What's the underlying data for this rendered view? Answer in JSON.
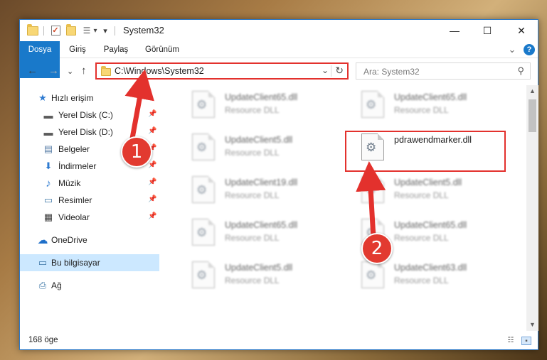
{
  "window": {
    "title": "System32",
    "controls": {
      "minimize": "—",
      "maximize": "☐",
      "close": "✕"
    }
  },
  "quick_access_toolbar": {
    "dropdown_glyph": "▾"
  },
  "ribbon": {
    "tabs": [
      {
        "label": "Dosya"
      },
      {
        "label": "Giriş"
      },
      {
        "label": "Paylaş"
      },
      {
        "label": "Görünüm"
      }
    ],
    "expand_glyph": "⌄",
    "help_glyph": "?"
  },
  "navigation": {
    "back": "←",
    "forward": "→",
    "recent": "⌄",
    "up": "↑",
    "address": "C:\\Windows\\System32",
    "address_dropdown": "⌄",
    "refresh": "↻",
    "search_placeholder": "Ara: System32",
    "search_glyph": "⚲"
  },
  "sidebar": {
    "items": [
      {
        "label": "Hızlı erişim",
        "icon": "star-icon",
        "glyph": "★",
        "color": "#2f7bd1"
      },
      {
        "label": "Yerel Disk (C:)",
        "icon": "drive-c-icon",
        "glyph": "▬",
        "color": "#5b5b5b",
        "pin": "📌"
      },
      {
        "label": "Yerel Disk (D:)",
        "icon": "drive-d-icon",
        "glyph": "▬",
        "color": "#5b5b5b",
        "pin": "📌"
      },
      {
        "label": "Belgeler",
        "icon": "documents-icon",
        "glyph": "▤",
        "color": "#5a7fa8",
        "pin": "📌"
      },
      {
        "label": "İndirmeler",
        "icon": "downloads-icon",
        "glyph": "⬇",
        "color": "#2f7bd1",
        "pin": "📌"
      },
      {
        "label": "Müzik",
        "icon": "music-icon",
        "glyph": "♪",
        "color": "#2f7bd1",
        "pin": "📌"
      },
      {
        "label": "Resimler",
        "icon": "pictures-icon",
        "glyph": "▭",
        "color": "#3f78a8",
        "pin": "📌"
      },
      {
        "label": "Videolar",
        "icon": "videos-icon",
        "glyph": "▦",
        "color": "#3c3c3c",
        "pin": "📌"
      },
      {
        "label": "OneDrive",
        "icon": "onedrive-icon",
        "glyph": "☁",
        "color": "#1e6fc9"
      },
      {
        "label": "Bu bilgisayar",
        "icon": "computer-icon",
        "glyph": "▭",
        "color": "#3f78a8",
        "selected": true
      },
      {
        "label": "Ağ",
        "icon": "network-icon",
        "glyph": "⎙",
        "color": "#3f78a8"
      }
    ]
  },
  "files": {
    "left_column": [
      {
        "name": "UpdateClient65.dll",
        "type": "Resource DLL"
      },
      {
        "name": "UpdateClient5.dll",
        "type": "Resource DLL"
      },
      {
        "name": "UpdateClient19.dll",
        "type": "Resource DLL"
      },
      {
        "name": "UpdateClient65.dll",
        "type": "Resource DLL"
      },
      {
        "name": "UpdateClient5.dll",
        "type": "Resource DLL"
      }
    ],
    "right_column": [
      {
        "name": "UpdateClient65.dll",
        "type": "Resource DLL"
      },
      {
        "name": "pdrawendmarker.dll",
        "type": ""
      },
      {
        "name": "UpdateClient5.dll",
        "type": "Resource DLL"
      },
      {
        "name": "UpdateClient65.dll",
        "type": "Resource DLL"
      },
      {
        "name": "UpdateClient63.dll",
        "type": "Resource DLL"
      }
    ]
  },
  "status": {
    "item_count": "168 öge"
  },
  "annotations": {
    "badge_1": "1",
    "badge_2": "2",
    "color": "#e3312d"
  }
}
